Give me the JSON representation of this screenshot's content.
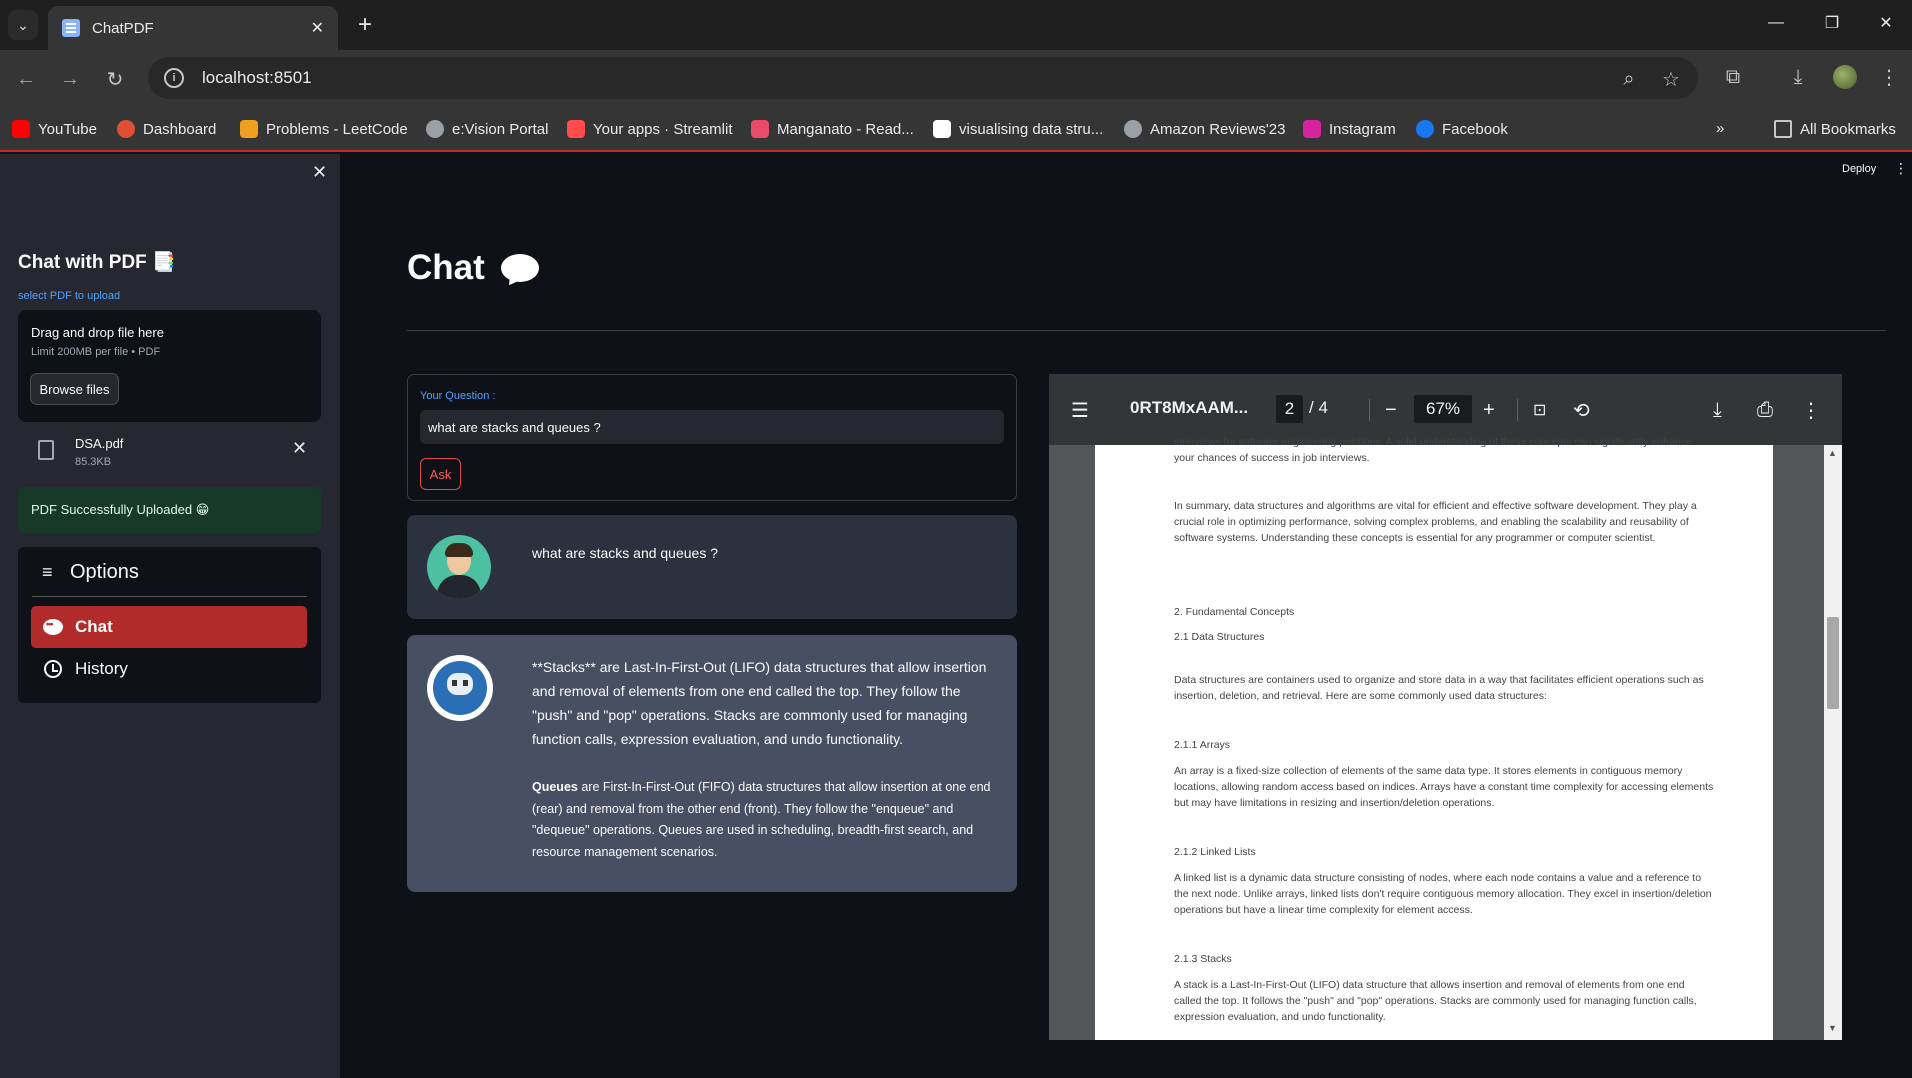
{
  "browser": {
    "tab_title": "ChatPDF",
    "url": "localhost:8501",
    "bookmarks": [
      {
        "label": "YouTube",
        "color": "#ff0000"
      },
      {
        "label": "Dashboard",
        "color": "#e05030"
      },
      {
        "label": "Problems - LeetCode",
        "color": "#f0a020"
      },
      {
        "label": "e:Vision Portal",
        "color": "#9aa0a6"
      },
      {
        "label": "Your apps · Streamlit",
        "color": "#ff4b4b"
      },
      {
        "label": "Manganato - Read...",
        "color": "#e84a6a"
      },
      {
        "label": "visualising data stru...",
        "color": "#ffffff"
      },
      {
        "label": "Amazon Reviews'23",
        "color": "#9aa0a6"
      },
      {
        "label": "Instagram",
        "color": "#d6249f"
      },
      {
        "label": "Facebook",
        "color": "#1877f2"
      }
    ],
    "all_bookmarks": "All Bookmarks"
  },
  "sidebar": {
    "title": "Chat with PDF 📑",
    "upload_label": "select PDF to upload",
    "dropzone_title": "Drag and drop file here",
    "dropzone_sub": "Limit 200MB per file • PDF",
    "browse_label": "Browse files",
    "file_name": "DSA.pdf",
    "file_size": "85.3KB",
    "success_text": "PDF Successfully Uploaded 😁",
    "menu_title": "Options",
    "menu_items": [
      {
        "label": "Chat",
        "active": true
      },
      {
        "label": "History",
        "active": false
      }
    ]
  },
  "main": {
    "deploy": "Deploy",
    "title": "Chat",
    "question_label": "Your Question :",
    "question_value": "what are stacks and queues ?",
    "ask_label": "Ask",
    "user_message": "what are stacks and queues ?",
    "bot_paragraph_1": "**Stacks** are Last-In-First-Out (LIFO) data structures that allow insertion and removal of elements from one end called the top. They follow the \"push\" and \"pop\" operations. Stacks are commonly used for managing function calls, expression evaluation, and undo functionality.",
    "bot_p2_bold": "Queues",
    "bot_p2_rest": " are First-In-First-Out (FIFO) data structures that allow insertion at one end (rear) and removal from the other end (front). They follow the \"enqueue\" and \"dequeue\" operations. Queues are used in scheduling, breadth-first search, and resource management scenarios."
  },
  "pdf": {
    "name": "0RT8MxAAM...",
    "page": "2",
    "total": "/  4",
    "zoom": "67%",
    "lines": {
      "intro_tail": "interviews for software engineering positions. A solid understanding of these concepts can significantly enhance your chances of success in job interviews.",
      "summary": "In summary, data structures and algorithms are vital for efficient and effective software development. They play a crucial role in optimizing performance, solving complex problems, and enabling the scalability and reusability of software systems. Understanding these concepts is essential for any programmer or computer scientist.",
      "h_fundamentals": "2. Fundamental Concepts",
      "h_ds": "2.1 Data Structures",
      "ds_body": "Data structures are containers used to organize and store data in a way that facilitates efficient operations such as insertion, deletion, and retrieval. Here are some commonly used data structures:",
      "h_arrays": "2.1.1 Arrays",
      "arrays_body": "An array is a fixed-size collection of elements of the same data type. It stores elements in contiguous memory locations, allowing random access based on indices. Arrays have a constant time complexity for accessing elements but may have limitations in resizing and insertion/deletion operations.",
      "h_ll": "2.1.2 Linked Lists",
      "ll_body": "A linked list is a dynamic data structure consisting of nodes, where each node contains a value and a reference to the next node. Unlike arrays, linked lists don't require contiguous memory allocation. They excel in insertion/deletion operations but have a linear time complexity for element access.",
      "h_stacks": "2.1.3 Stacks",
      "stacks_body": "A stack is a Last-In-First-Out (LIFO) data structure that allows insertion and removal of elements from one end called the top. It follows the \"push\" and \"pop\" operations. Stacks are commonly used for managing function calls, expression evaluation, and undo functionality."
    }
  },
  "colors": {
    "accent": "#ff4b4b",
    "active_menu": "#b22b2b",
    "app_bg": "#0e1117",
    "sidebar_bg": "#262730"
  }
}
